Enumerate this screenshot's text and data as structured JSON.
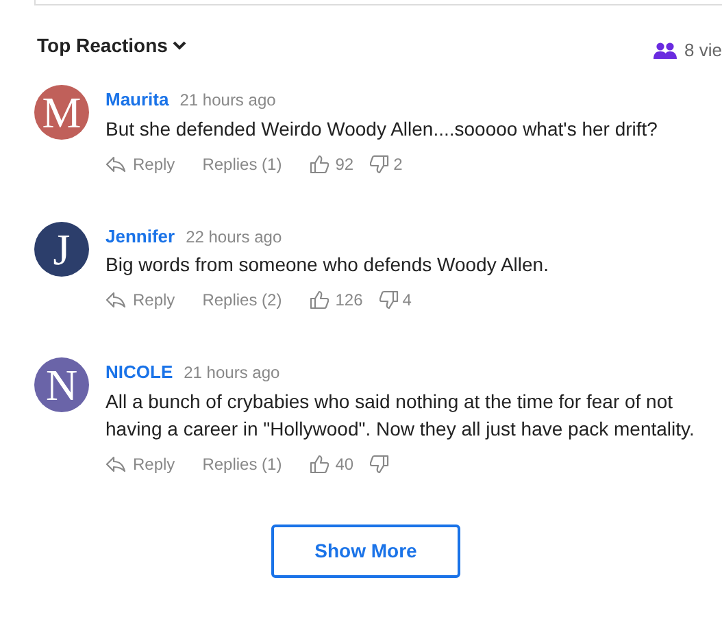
{
  "header": {
    "sort_label": "Top Reactions",
    "viewers": "8 vie"
  },
  "comments": [
    {
      "initial": "M",
      "color": "#c0605a",
      "author": "Maurita",
      "time": "21 hours ago",
      "text": "But she defended Weirdo Woody Allen....sooooo what's her drift?",
      "reply": "Reply",
      "replies": "Replies (1)",
      "likes": "92",
      "dislikes": "2"
    },
    {
      "initial": "J",
      "color": "#2c3e6b",
      "author": "Jennifer",
      "time": "22 hours ago",
      "text": "Big words from someone who defends Woody Allen.",
      "reply": "Reply",
      "replies": "Replies (2)",
      "likes": "126",
      "dislikes": "4"
    },
    {
      "initial": "N",
      "color": "#6a64a8",
      "author": "NICOLE",
      "time": "21 hours ago",
      "text": "All a bunch of crybabies who said nothing at the time for fear of not having a career in \"Hollywood\". Now they all just have pack mentality.",
      "reply": "Reply",
      "replies": "Replies (1)",
      "likes": "40"
    }
  ],
  "show_more": "Show More"
}
